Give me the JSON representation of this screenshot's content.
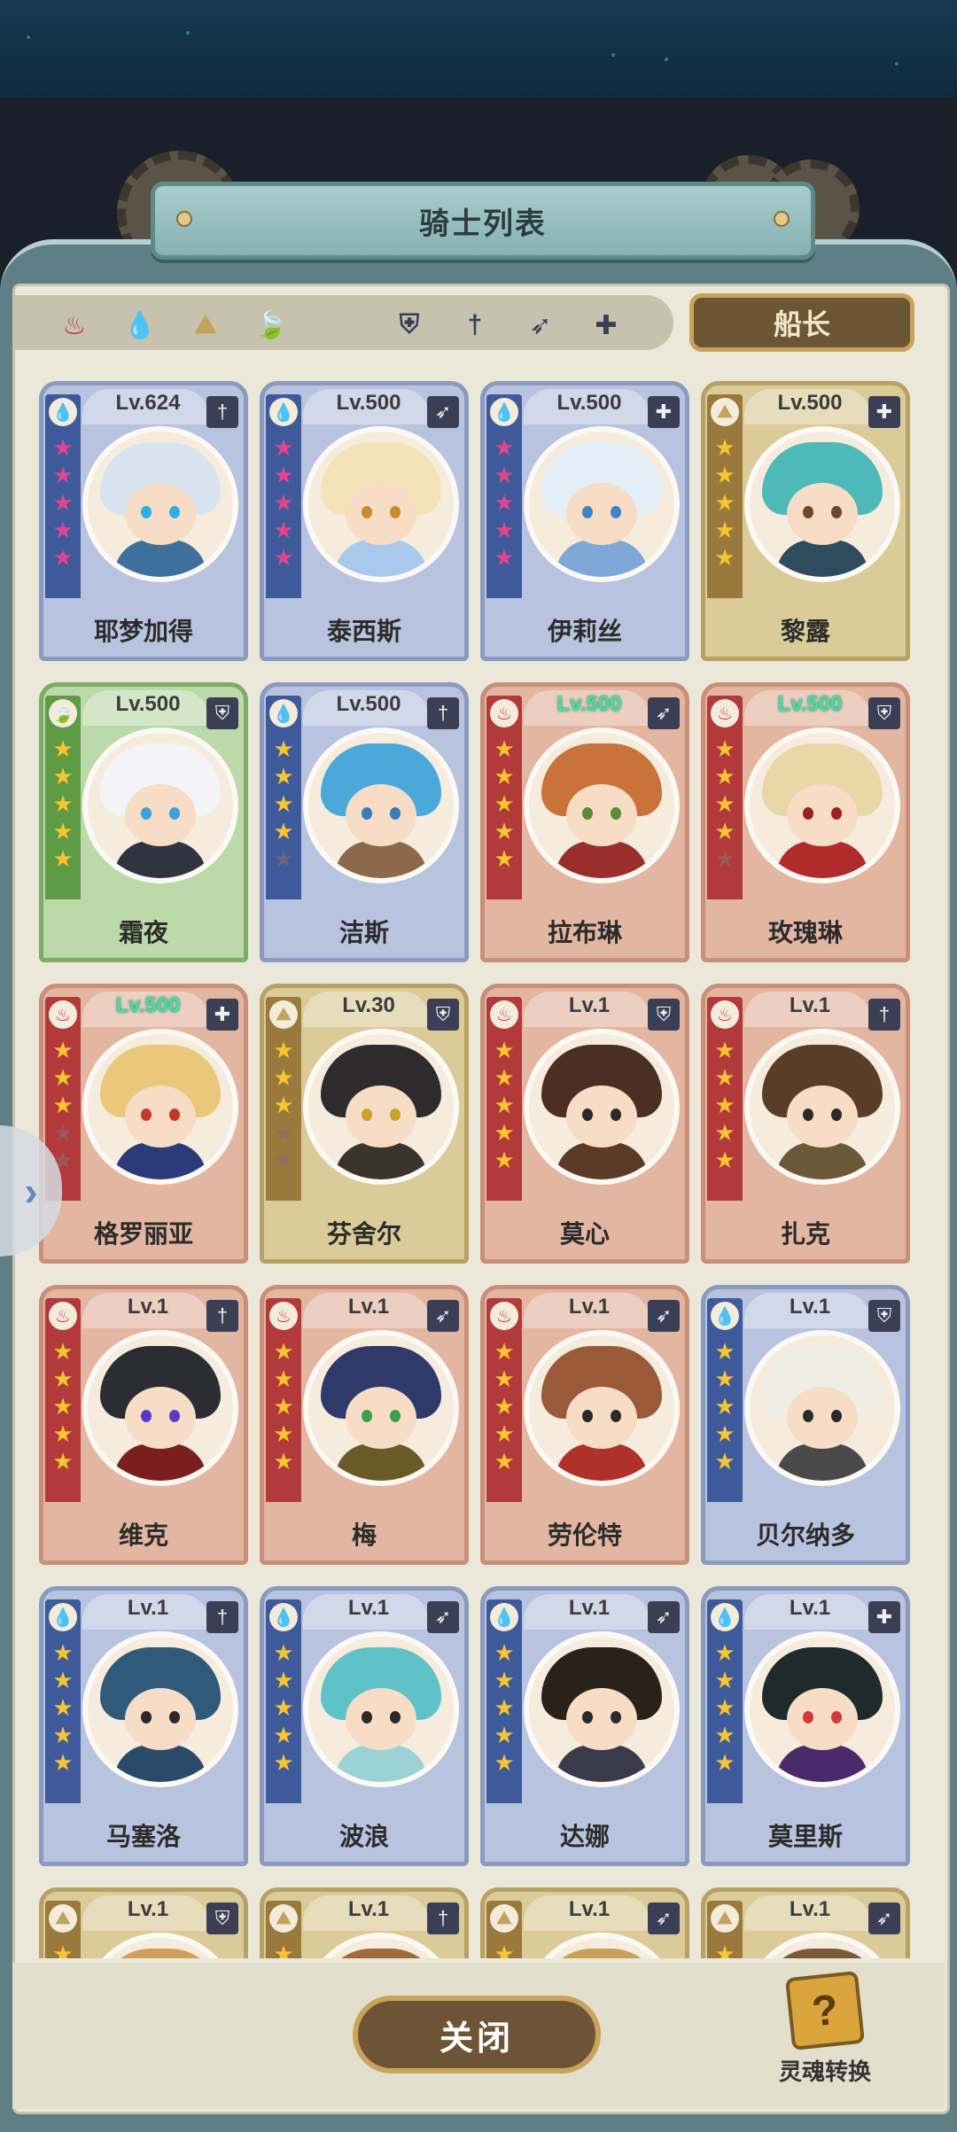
{
  "window": {
    "title": "骑士列表"
  },
  "filters": {
    "elements": [
      {
        "name": "fire",
        "glyph": "♨",
        "color": "#c2324a"
      },
      {
        "name": "water",
        "glyph": "💧",
        "color": "#3a67b6"
      },
      {
        "name": "earth",
        "glyph": "⛰",
        "color": "#c1a35c"
      },
      {
        "name": "wind",
        "glyph": "🍃",
        "color": "#6aa34a"
      }
    ],
    "classes": [
      {
        "name": "shield",
        "glyph": "⛨"
      },
      {
        "name": "sword",
        "glyph": "†"
      },
      {
        "name": "bow",
        "glyph": "➶"
      },
      {
        "name": "cross",
        "glyph": "✚"
      }
    ],
    "captain_label": "船长"
  },
  "cards": [
    {
      "level": "Lv.624",
      "name": "耶梦加得",
      "theme": "blue",
      "element": "water",
      "class": "sword",
      "stars": [
        "pink",
        "pink",
        "pink",
        "pink",
        "pink"
      ],
      "highlight": false,
      "hair": "#d8e4ef",
      "body": "#3f6f9c",
      "eye": "#2ab0e6"
    },
    {
      "level": "Lv.500",
      "name": "泰西斯",
      "theme": "blue",
      "element": "water",
      "class": "bow",
      "stars": [
        "pink",
        "pink",
        "pink",
        "pink",
        "pink"
      ],
      "highlight": false,
      "hair": "#f4e3b8",
      "body": "#a9c9ec",
      "eye": "#c98a2e"
    },
    {
      "level": "Lv.500",
      "name": "伊莉丝",
      "theme": "blue",
      "element": "water",
      "class": "cross",
      "stars": [
        "pink",
        "pink",
        "pink",
        "pink",
        "pink"
      ],
      "highlight": false,
      "hair": "#e4eef6",
      "body": "#7fa8d8",
      "eye": "#3f84c9"
    },
    {
      "level": "Lv.500",
      "name": "黎露",
      "theme": "gold",
      "element": "earth",
      "class": "cross",
      "stars": [
        "yellow",
        "yellow",
        "yellow",
        "yellow",
        "yellow"
      ],
      "highlight": false,
      "hair": "#4fb9b9",
      "body": "#2f4b5e",
      "eye": "#6a4a2a"
    },
    {
      "level": "Lv.500",
      "name": "霜夜",
      "theme": "green",
      "element": "wind",
      "class": "shield",
      "stars": [
        "yellow",
        "yellow",
        "yellow",
        "yellow",
        "yellow"
      ],
      "highlight": false,
      "hair": "#f4f4f6",
      "body": "#2f3440",
      "eye": "#3aa0e0"
    },
    {
      "level": "Lv.500",
      "name": "洁斯",
      "theme": "blue",
      "element": "water",
      "class": "sword",
      "stars": [
        "yellow",
        "yellow",
        "yellow",
        "yellow",
        "dim"
      ],
      "highlight": false,
      "hair": "#4aa9d8",
      "body": "#8a6a4a",
      "eye": "#3a7ab8"
    },
    {
      "level": "Lv.500",
      "name": "拉布琳",
      "theme": "red",
      "element": "fire",
      "class": "bow",
      "stars": [
        "yellow",
        "yellow",
        "yellow",
        "yellow",
        "yellow"
      ],
      "highlight": true,
      "hair": "#c9723a",
      "body": "#9a2e2e",
      "eye": "#5a8a3a"
    },
    {
      "level": "Lv.500",
      "name": "玫瑰琳",
      "theme": "red",
      "element": "fire",
      "class": "shield",
      "stars": [
        "yellow",
        "yellow",
        "yellow",
        "yellow",
        "dim"
      ],
      "highlight": true,
      "hair": "#ead7a8",
      "body": "#b02c2c",
      "eye": "#a02020"
    },
    {
      "level": "Lv.500",
      "name": "格罗丽亚",
      "theme": "red",
      "element": "fire",
      "class": "cross",
      "stars": [
        "yellow",
        "yellow",
        "yellow",
        "dim",
        "dim"
      ],
      "highlight": true,
      "hair": "#e9c87a",
      "body": "#2b3a78",
      "eye": "#c0392b"
    },
    {
      "level": "Lv.30",
      "name": "芬舍尔",
      "theme": "gold",
      "element": "earth",
      "class": "shield",
      "stars": [
        "yellow",
        "yellow",
        "yellow",
        "dim",
        "dim"
      ],
      "highlight": false,
      "hair": "#2d2b2b",
      "body": "#3a342c",
      "eye": "#c7a52a"
    },
    {
      "level": "Lv.1",
      "name": "莫心",
      "theme": "red",
      "element": "fire",
      "class": "shield",
      "stars": [
        "yellow",
        "yellow",
        "yellow",
        "yellow",
        "yellow"
      ],
      "highlight": false,
      "hair": "#4a2f22",
      "body": "#5b3a28",
      "eye": "#2a2a2a"
    },
    {
      "level": "Lv.1",
      "name": "扎克",
      "theme": "red",
      "element": "fire",
      "class": "sword",
      "stars": [
        "yellow",
        "yellow",
        "yellow",
        "yellow",
        "yellow"
      ],
      "highlight": false,
      "hair": "#5a3d28",
      "body": "#6a5a3a",
      "eye": "#2a2a2a"
    },
    {
      "level": "Lv.1",
      "name": "维克",
      "theme": "red",
      "element": "fire",
      "class": "sword",
      "stars": [
        "yellow",
        "yellow",
        "yellow",
        "yellow",
        "yellow"
      ],
      "highlight": false,
      "hair": "#2c2c34",
      "body": "#7a1f1f",
      "eye": "#5a3ac9"
    },
    {
      "level": "Lv.1",
      "name": "梅",
      "theme": "red",
      "element": "fire",
      "class": "bow",
      "stars": [
        "yellow",
        "yellow",
        "yellow",
        "yellow",
        "yellow"
      ],
      "highlight": false,
      "hair": "#2f3a6a",
      "body": "#6a5a2a",
      "eye": "#3aa04a"
    },
    {
      "level": "Lv.1",
      "name": "劳伦特",
      "theme": "red",
      "element": "fire",
      "class": "bow",
      "stars": [
        "yellow",
        "yellow",
        "yellow",
        "yellow",
        "yellow"
      ],
      "highlight": false,
      "hair": "#9a5a3a",
      "body": "#b0302a",
      "eye": "#2a2a2a"
    },
    {
      "level": "Lv.1",
      "name": "贝尔纳多",
      "theme": "blue",
      "element": "water",
      "class": "shield",
      "stars": [
        "yellow",
        "yellow",
        "yellow",
        "yellow",
        "yellow"
      ],
      "highlight": false,
      "hair": "#f0ede4",
      "body": "#4a4a4a",
      "eye": "#2a2a2a"
    },
    {
      "level": "Lv.1",
      "name": "马塞洛",
      "theme": "blue",
      "element": "water",
      "class": "sword",
      "stars": [
        "yellow",
        "yellow",
        "yellow",
        "yellow",
        "yellow"
      ],
      "highlight": false,
      "hair": "#2f5a7a",
      "body": "#2a4a6a",
      "eye": "#2a2a2a"
    },
    {
      "level": "Lv.1",
      "name": "波浪",
      "theme": "blue",
      "element": "water",
      "class": "bow",
      "stars": [
        "yellow",
        "yellow",
        "yellow",
        "yellow",
        "yellow"
      ],
      "highlight": false,
      "hair": "#5fc2c9",
      "body": "#9ad2d6",
      "eye": "#2a2a2a"
    },
    {
      "level": "Lv.1",
      "name": "达娜",
      "theme": "blue",
      "element": "water",
      "class": "bow",
      "stars": [
        "yellow",
        "yellow",
        "yellow",
        "yellow",
        "yellow"
      ],
      "highlight": false,
      "hair": "#2a211a",
      "body": "#3a3a4a",
      "eye": "#2a2a2a"
    },
    {
      "level": "Lv.1",
      "name": "莫里斯",
      "theme": "blue",
      "element": "water",
      "class": "cross",
      "stars": [
        "yellow",
        "yellow",
        "yellow",
        "yellow",
        "yellow"
      ],
      "highlight": false,
      "hair": "#1f2a2a",
      "body": "#4a2a6a",
      "eye": "#d03a3a"
    },
    {
      "level": "Lv.1",
      "name": "",
      "theme": "gold",
      "element": "earth",
      "class": "shield",
      "stars": [
        "yellow",
        "yellow"
      ],
      "highlight": false,
      "hair": "#d0a05a",
      "body": "#7a5a3a",
      "eye": "#2a2a2a"
    },
    {
      "level": "Lv.1",
      "name": "",
      "theme": "gold",
      "element": "earth",
      "class": "sword",
      "stars": [
        "yellow",
        "yellow"
      ],
      "highlight": false,
      "hair": "#a06a3a",
      "body": "#7a5a3a",
      "eye": "#2a2a2a"
    },
    {
      "level": "Lv.1",
      "name": "",
      "theme": "gold",
      "element": "earth",
      "class": "bow",
      "stars": [
        "yellow",
        "yellow"
      ],
      "highlight": false,
      "hair": "#c9a05a",
      "body": "#7a5a3a",
      "eye": "#2a2a2a"
    },
    {
      "level": "Lv.1",
      "name": "",
      "theme": "gold",
      "element": "earth",
      "class": "bow",
      "stars": [
        "yellow",
        "yellow"
      ],
      "highlight": false,
      "hair": "#7a5a3a",
      "body": "#7a5a3a",
      "eye": "#2a2a2a"
    }
  ],
  "footer": {
    "close_label": "关闭",
    "soul_label": "灵魂转换",
    "soul_glyph": "?"
  },
  "side_tab": {
    "glyph": "›"
  }
}
